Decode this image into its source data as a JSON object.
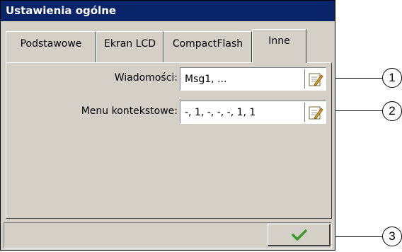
{
  "window": {
    "title": "Ustawienia ogólne"
  },
  "tabs": [
    {
      "label": "Podstawowe",
      "active": false
    },
    {
      "label": "Ekran LCD",
      "active": false
    },
    {
      "label": "CompactFlash",
      "active": false
    },
    {
      "label": "Inne",
      "active": true
    }
  ],
  "fields": [
    {
      "label": "Wiadomości:",
      "value": "Msg1, ...",
      "action_icon": "edit-icon"
    },
    {
      "label": "Menu kontekstowe:",
      "value": "-, 1, -, -, -, 1, 1",
      "action_icon": "edit-icon"
    }
  ],
  "footer": {
    "ok_icon": "checkmark-icon",
    "ok_color": "#3a9a2a"
  },
  "callouts": [
    "1",
    "2",
    "3"
  ]
}
